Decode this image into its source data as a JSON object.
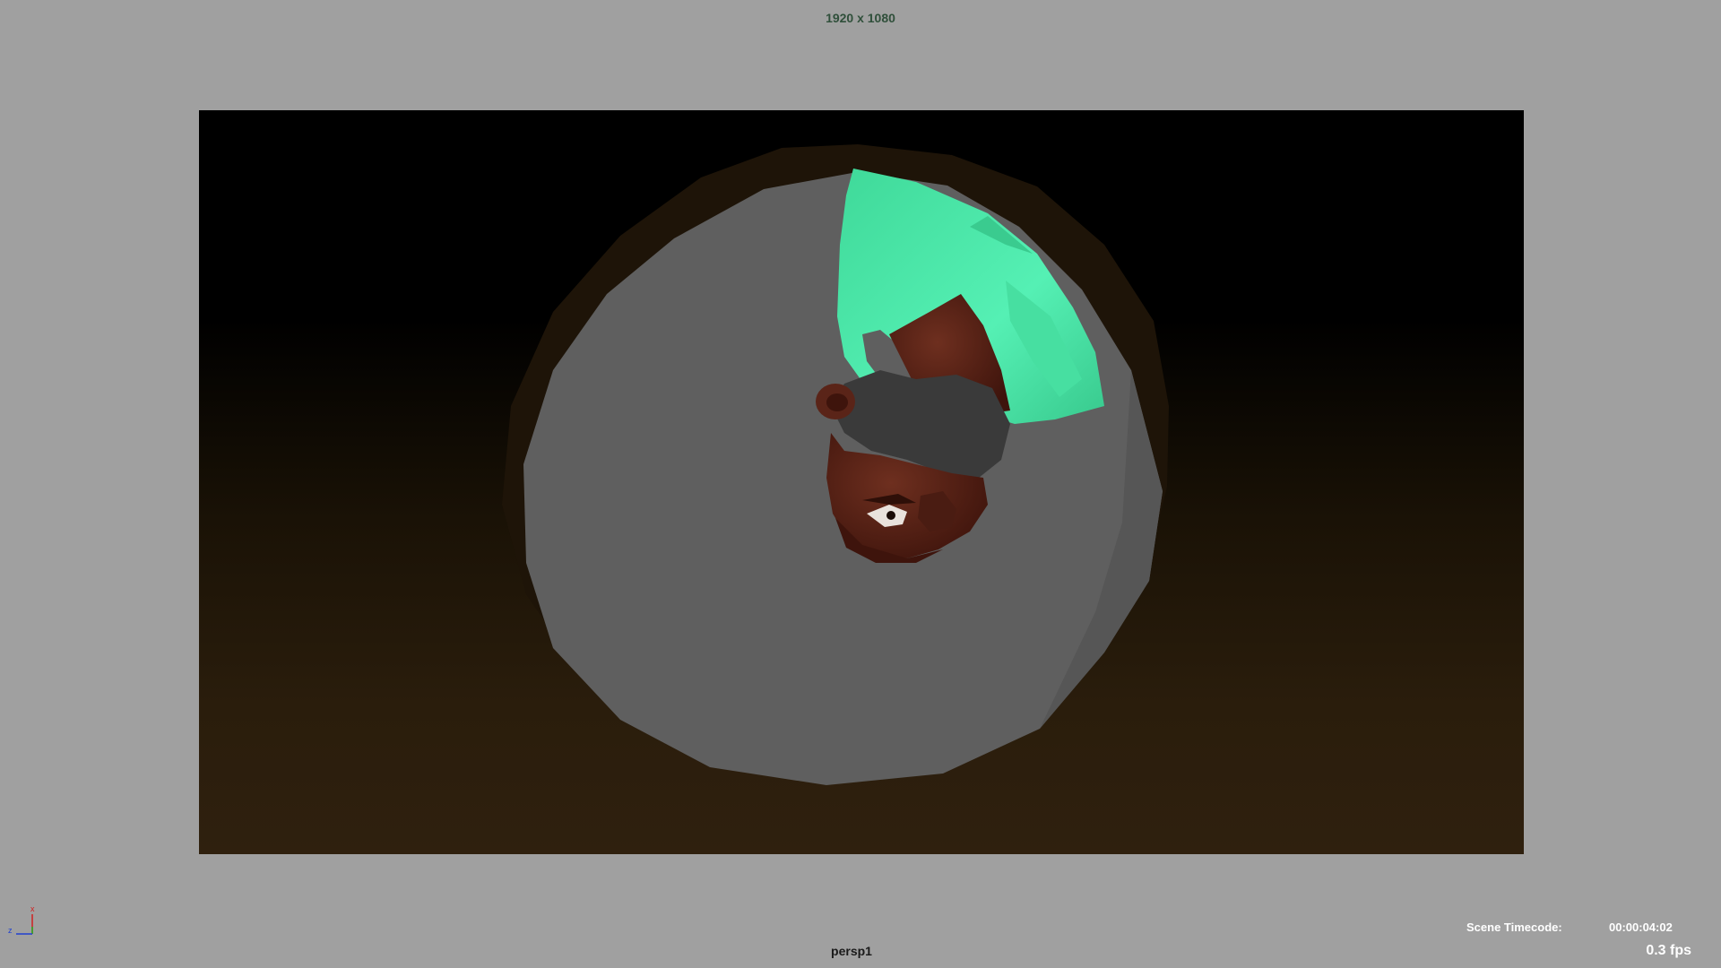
{
  "viewport": {
    "resolution_label": "1920 x 1080",
    "camera_name": "persp1",
    "background_color": "#a0a0a0"
  },
  "hud": {
    "scene_timecode_label": "Scene Timecode:",
    "scene_timecode_value": "00:00:04:02",
    "fps": "0.3 fps"
  },
  "axis_gizmo": {
    "x_label": "x",
    "z_label": "z",
    "x_color": "#d02020",
    "y_color": "#20b020",
    "z_color": "#2040d0"
  },
  "scene": {
    "shirt_color": "#4ee8a8",
    "skin_color": "#5a2418",
    "tube_color": "#5f5f5f"
  }
}
